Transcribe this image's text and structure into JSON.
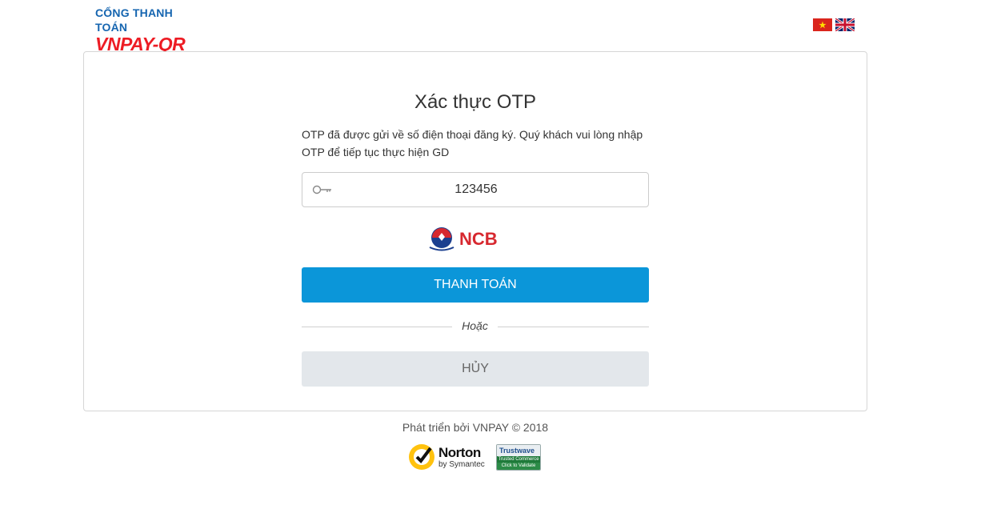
{
  "header": {
    "logo_top": "CỔNG THANH TOÁN",
    "logo_bottom": "VNPAY-QR",
    "languages": [
      "vi",
      "en"
    ]
  },
  "otp_form": {
    "title": "Xác thực OTP",
    "description": "OTP đã được gửi về số điện thoại đăng ký. Quý khách vui lòng nhập OTP để tiếp tục thực hiện GD",
    "otp_value": "123456",
    "bank_name": "NCB",
    "pay_label": "THANH TOÁN",
    "or_label": "Hoặc",
    "cancel_label": "HỦY"
  },
  "footer": {
    "developed_by": "Phát triển bởi VNPAY © 2018",
    "norton_name": "Norton",
    "norton_sub": "by Symantec",
    "trustwave_name": "Trustwave",
    "trustwave_line1": "Trusted Commerce",
    "trustwave_line2": "Click to Validate"
  },
  "colors": {
    "pay_button": "#0b96d9",
    "cancel_button": "#e3e7eb",
    "brand_red": "#ed1c24",
    "brand_blue": "#1565b0"
  },
  "icons": {
    "otp_field": "key-icon",
    "vi_flag": "vietnam-flag-icon",
    "en_flag": "uk-flag-icon"
  }
}
